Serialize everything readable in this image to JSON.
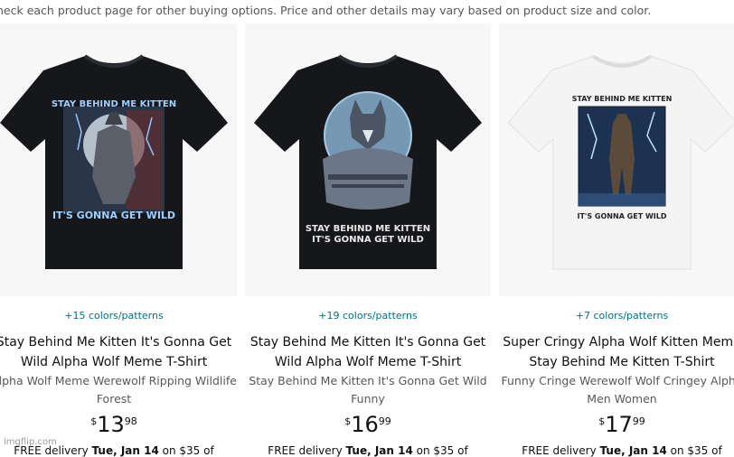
{
  "notice": "heck each product page for other buying options. Price and other details may vary based on product size and color.",
  "products": [
    {
      "colors": "+15 colors/patterns",
      "title_line1": "Stay Behind Me Kitten It's Gonna Get",
      "title_line2": "Wild Alpha Wolf Meme T-Shirt",
      "subtitle_line1": "Alpha Wolf Meme Werewolf Ripping Wildlife",
      "subtitle_line2": "Forest",
      "price_symbol": "$",
      "price_whole": "13",
      "price_fraction": "98",
      "delivery_prefix": "FREE delivery ",
      "delivery_date": "Tue, Jan 14",
      "delivery_suffix": " on $35 of",
      "shirt_color": "#15171a",
      "shirt_text_top": "STAY BEHIND ME KITTEN",
      "shirt_text_bottom": "IT'S GONNA GET WILD"
    },
    {
      "colors": "+19 colors/patterns",
      "title_line1": "Stay Behind Me Kitten It's Gonna Get",
      "title_line2": "Wild Alpha Wolf Meme T-Shirt",
      "subtitle_line1": "Stay Behind Me Kitten It's Gonna Get Wild",
      "subtitle_line2": "Funny",
      "price_symbol": "$",
      "price_whole": "16",
      "price_fraction": "99",
      "delivery_prefix": "FREE delivery ",
      "delivery_date": "Tue, Jan 14",
      "delivery_suffix": " on $35 of",
      "shirt_color": "#15171a",
      "shirt_text_top": "STAY BEHIND ME KITTEN",
      "shirt_text_bottom": "IT'S GONNA GET WILD"
    },
    {
      "colors": "+7 colors/patterns",
      "title_line1": "Super Cringy Alpha Wolf Kitten Meme",
      "title_line2": "Stay Behind Me Kitten T-Shirt",
      "subtitle_line1": "Funny Cringe Werewolf Wolf Cringey Alpha",
      "subtitle_line2": "Men Women",
      "price_symbol": "$",
      "price_whole": "17",
      "price_fraction": "99",
      "delivery_prefix": "FREE delivery ",
      "delivery_date": "Tue, Jan 14",
      "delivery_suffix": " on $35 of",
      "shirt_color": "#f4f4f4",
      "shirt_text_top": "STAY BEHIND ME KITTEN",
      "shirt_text_bottom": "IT'S GONNA GET WILD"
    }
  ],
  "watermark": "imgflip.com"
}
